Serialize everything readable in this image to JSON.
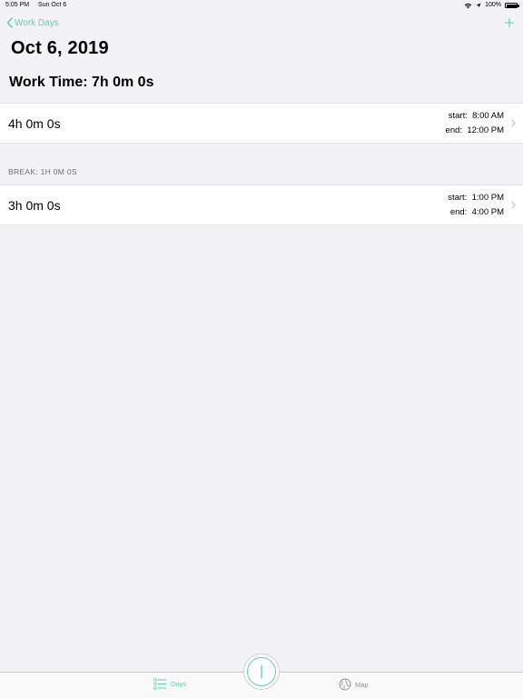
{
  "status_bar": {
    "time": "5:05 PM",
    "date": "Sun Oct 6",
    "battery": "100%"
  },
  "nav": {
    "back_label": "Work Days"
  },
  "title": "Oct 6, 2019",
  "work_time": "Work Time: 7h 0m 0s",
  "entries": [
    {
      "duration": "4h 0m 0s",
      "start_label": "start:",
      "start": "8:00 AM",
      "end_label": "end:",
      "end": "12:00 PM"
    },
    {
      "duration": "3h 0m 0s",
      "start_label": "start:",
      "start": "1:00 PM",
      "end_label": "end:",
      "end": "4:00 PM"
    }
  ],
  "break_header": "BREAK: 1H 0M 0S",
  "tabs": {
    "days": "Days",
    "map": "Map"
  },
  "colors": {
    "accent": "#5ecfa8",
    "background": "#f2f2f7"
  }
}
